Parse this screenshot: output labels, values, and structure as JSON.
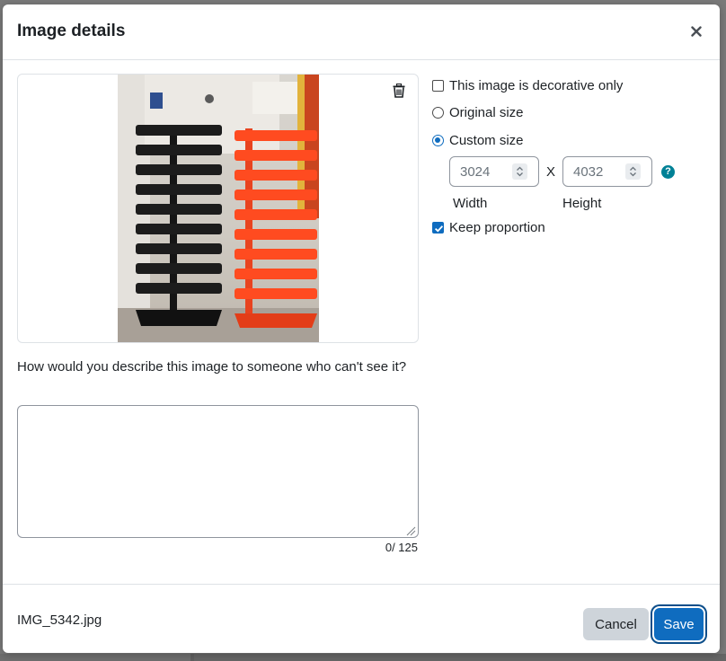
{
  "dialog": {
    "title": "Image details",
    "close_label": "×"
  },
  "image": {
    "filename": "IMG_5342.jpg",
    "delete_icon": "trash-icon"
  },
  "options": {
    "decorative_label": "This image is decorative only",
    "decorative_checked": false,
    "original_size_label": "Original size",
    "custom_size_label": "Custom size",
    "selected_size": "custom",
    "width_value": "3024",
    "height_value": "4032",
    "separator": "X",
    "width_label": "Width",
    "height_label": "Height",
    "help_glyph": "?",
    "keep_proportion_label": "Keep proportion",
    "keep_proportion_checked": true
  },
  "description": {
    "label": "How would you describe this image to someone who can't see it?",
    "value": "",
    "char_count": "0/ 125"
  },
  "footer": {
    "cancel_label": "Cancel",
    "save_label": "Save"
  },
  "colors": {
    "primary": "#0f6cbf",
    "help": "#008196",
    "secondary_btn": "#ced4da"
  }
}
